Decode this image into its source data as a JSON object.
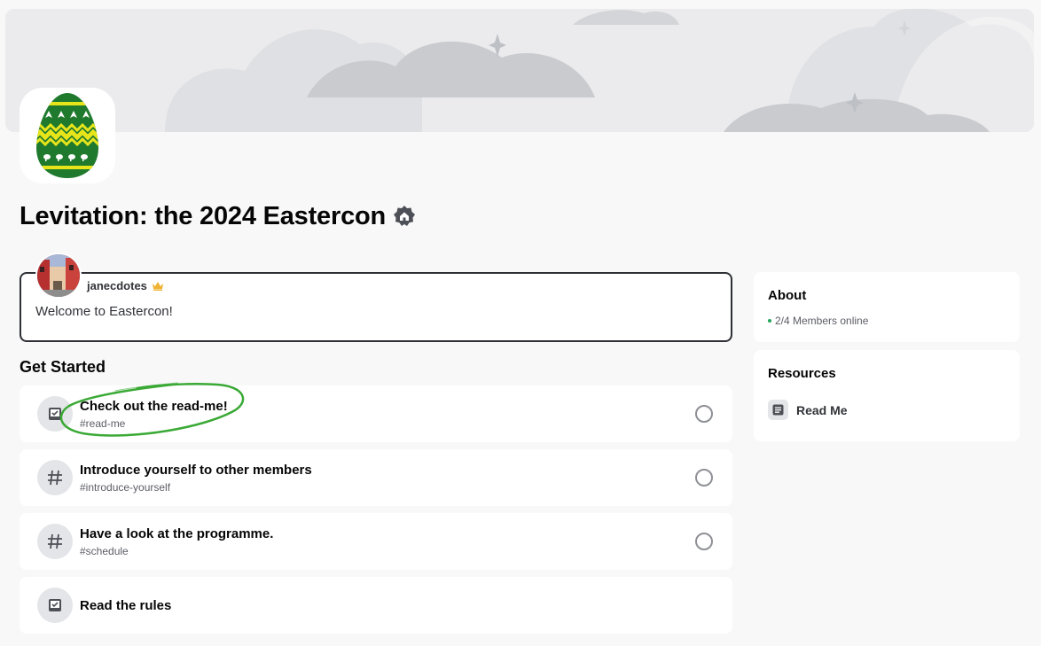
{
  "server": {
    "name": "Levitation: the 2024 Eastercon",
    "icons": {
      "server_icon": "easter-egg-icon",
      "badge": "community-badge-icon"
    }
  },
  "welcome": {
    "author": "janecdotes",
    "author_badge": "crown-icon",
    "message": "Welcome to Eastercon!"
  },
  "get_started": {
    "title": "Get Started",
    "tasks": [
      {
        "title": "Check out the read-me!",
        "channel": "#read-me",
        "icon": "checklist-icon"
      },
      {
        "title": "Introduce yourself to other members",
        "channel": "#introduce-yourself",
        "icon": "hash-icon"
      },
      {
        "title": "Have a look at the programme.",
        "channel": "#schedule",
        "icon": "hash-icon"
      },
      {
        "title": "Read the rules",
        "channel": "",
        "icon": "checklist-icon"
      }
    ]
  },
  "about": {
    "title": "About",
    "online": "2/4 Members online"
  },
  "resources": {
    "title": "Resources",
    "items": [
      {
        "label": "Read Me",
        "icon": "document-icon"
      }
    ]
  },
  "colors": {
    "background": "#f8f8f8",
    "card": "#ffffff",
    "online_green": "#23a55a",
    "highlight_green": "#3aa935",
    "egg_green": "#1f7a2e",
    "egg_yellow": "#e7e51a"
  }
}
